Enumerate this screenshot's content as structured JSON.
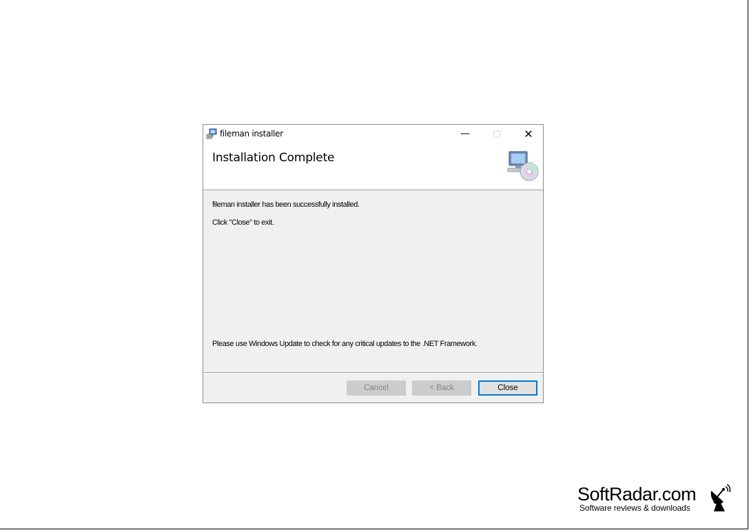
{
  "window": {
    "title": "fileman installer",
    "controls": {
      "minimize": "—",
      "maximize": "□",
      "close": "✕"
    }
  },
  "header": {
    "title": "Installation Complete",
    "icon": "computer-cd-icon"
  },
  "body": {
    "line1": "fileman installer has been successfully installed.",
    "line2": "Click \"Close\" to exit.",
    "line3": "Please use Windows Update to check for any critical updates to the .NET Framework."
  },
  "buttons": {
    "cancel": "Cancel",
    "back": "< Back",
    "close": "Close"
  },
  "watermark": {
    "title": "SoftRadar.com",
    "subtitle": "Software reviews & downloads",
    "icon": "satellite-dish-icon"
  },
  "colors": {
    "accent": "#0078d7",
    "dialog_bg": "#f0f0f0",
    "disabled_button": "#cccccc"
  }
}
